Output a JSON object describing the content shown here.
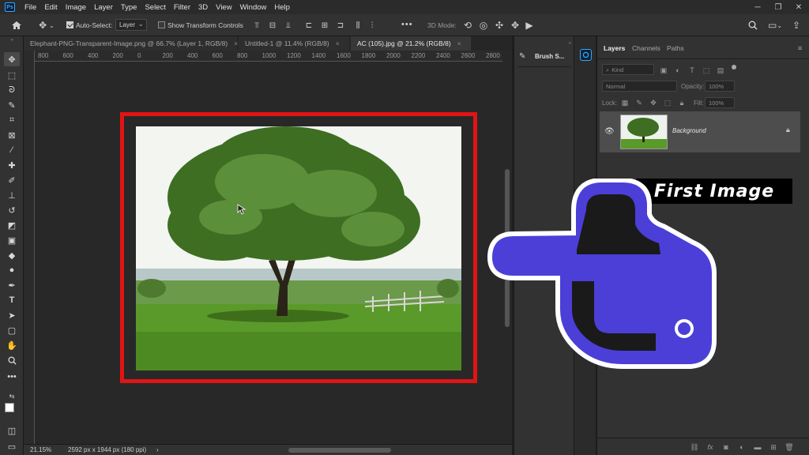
{
  "app": {
    "logo_text": "Ps"
  },
  "menu": [
    "File",
    "Edit",
    "Image",
    "Layer",
    "Type",
    "Select",
    "Filter",
    "3D",
    "View",
    "Window",
    "Help"
  ],
  "options": {
    "auto_select_label": "Auto-Select:",
    "auto_select_value": "Layer",
    "transform_label": "Show Transform Controls",
    "three_d_mode_label": "3D Mode:",
    "more_label": "•••"
  },
  "tabs": [
    {
      "label": "Elephant-PNG-Transparent-Image.png @ 66.7% (Layer 1, RGB/8)",
      "close": "×"
    },
    {
      "label": "Untitled-1 @ 11.4% (RGB/8)",
      "close": "×"
    },
    {
      "label": "AC (105).jpg @ 21.2% (RGB/8)",
      "close": "×"
    }
  ],
  "ruler_labels": [
    "800",
    "600",
    "400",
    "200",
    "0",
    "200",
    "400",
    "600",
    "800",
    "1000",
    "1200",
    "1400",
    "1600",
    "1800",
    "2000",
    "2200",
    "2400",
    "2600",
    "2800"
  ],
  "status": {
    "zoom": "21.15%",
    "doc_info": "2592 px x 1944 px (180 ppi)",
    "arrow": "›"
  },
  "brush_panel": {
    "label": "Brush S..."
  },
  "layers_panel": {
    "tabs": [
      "Layers",
      "Channels",
      "Paths"
    ],
    "kind_label": "Kind",
    "blend_mode": "Normal",
    "opacity_label": "Opacity:",
    "opacity_value": "100%",
    "lock_label": "Lock:",
    "fill_label": "Fill:",
    "fill_value": "100%",
    "layer_name": "Background"
  },
  "overlay": {
    "label": "First Image"
  },
  "colors": {
    "frame_red": "#e01414",
    "hand_fill": "#4b3fd8",
    "accent_blue": "#31a8ff"
  }
}
